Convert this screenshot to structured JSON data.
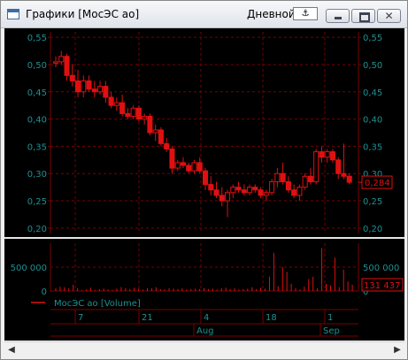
{
  "window": {
    "title": "Графики [МосЭС ао]",
    "period": "Дневной",
    "anchor_glyph": "⚓",
    "buttons": {
      "minimize": "minimize-icon",
      "maximize": "maximize-icon",
      "close": "✕"
    }
  },
  "price_panel": {
    "y_ticks": [
      "0,55",
      "0,50",
      "0,45",
      "0,40",
      "0,35",
      "0,30",
      "0,25",
      "0,20"
    ],
    "last_price": "0,284"
  },
  "volume_panel": {
    "y_ticks": [
      "500 000",
      "0"
    ],
    "last_volume": "131 437"
  },
  "legend": "МосЭС ао [Volume]",
  "time_axis": {
    "days": [
      "7",
      "21",
      "4",
      "18",
      "1"
    ],
    "months": [
      "Aug",
      "Sep"
    ]
  },
  "colors": {
    "candle": "#e01010",
    "grid": "#7a0000",
    "axis_text": "#1e9090",
    "background": "#000000"
  },
  "chart_data": {
    "type": "candlestick",
    "price_ylim": [
      0.19,
      0.56
    ],
    "volume_ylim": [
      0,
      1000000
    ],
    "candles": [
      [
        0.505,
        0.515,
        0.495,
        0.505
      ],
      [
        0.505,
        0.525,
        0.5,
        0.515
      ],
      [
        0.515,
        0.52,
        0.47,
        0.48
      ],
      [
        0.48,
        0.5,
        0.46,
        0.47
      ],
      [
        0.47,
        0.49,
        0.44,
        0.45
      ],
      [
        0.45,
        0.48,
        0.44,
        0.47
      ],
      [
        0.47,
        0.48,
        0.45,
        0.455
      ],
      [
        0.455,
        0.47,
        0.44,
        0.45
      ],
      [
        0.45,
        0.47,
        0.445,
        0.46
      ],
      [
        0.46,
        0.47,
        0.43,
        0.44
      ],
      [
        0.44,
        0.45,
        0.42,
        0.425
      ],
      [
        0.425,
        0.44,
        0.415,
        0.43
      ],
      [
        0.43,
        0.445,
        0.405,
        0.41
      ],
      [
        0.41,
        0.42,
        0.4,
        0.405
      ],
      [
        0.405,
        0.425,
        0.4,
        0.42
      ],
      [
        0.42,
        0.425,
        0.395,
        0.4
      ],
      [
        0.4,
        0.41,
        0.39,
        0.405
      ],
      [
        0.405,
        0.41,
        0.37,
        0.375
      ],
      [
        0.375,
        0.39,
        0.36,
        0.38
      ],
      [
        0.38,
        0.385,
        0.35,
        0.355
      ],
      [
        0.355,
        0.365,
        0.34,
        0.345
      ],
      [
        0.345,
        0.35,
        0.3,
        0.31
      ],
      [
        0.31,
        0.325,
        0.305,
        0.32
      ],
      [
        0.32,
        0.33,
        0.31,
        0.315
      ],
      [
        0.315,
        0.32,
        0.3,
        0.305
      ],
      [
        0.305,
        0.325,
        0.3,
        0.32
      ],
      [
        0.32,
        0.33,
        0.3,
        0.305
      ],
      [
        0.305,
        0.31,
        0.27,
        0.28
      ],
      [
        0.28,
        0.295,
        0.26,
        0.27
      ],
      [
        0.27,
        0.285,
        0.255,
        0.26
      ],
      [
        0.26,
        0.275,
        0.24,
        0.25
      ],
      [
        0.25,
        0.27,
        0.22,
        0.265
      ],
      [
        0.265,
        0.28,
        0.255,
        0.275
      ],
      [
        0.275,
        0.285,
        0.265,
        0.27
      ],
      [
        0.27,
        0.28,
        0.26,
        0.265
      ],
      [
        0.265,
        0.28,
        0.26,
        0.275
      ],
      [
        0.275,
        0.28,
        0.265,
        0.27
      ],
      [
        0.27,
        0.275,
        0.255,
        0.26
      ],
      [
        0.26,
        0.27,
        0.25,
        0.265
      ],
      [
        0.265,
        0.29,
        0.26,
        0.285
      ],
      [
        0.285,
        0.31,
        0.275,
        0.3
      ],
      [
        0.3,
        0.32,
        0.28,
        0.285
      ],
      [
        0.285,
        0.295,
        0.265,
        0.27
      ],
      [
        0.27,
        0.28,
        0.255,
        0.26
      ],
      [
        0.26,
        0.28,
        0.25,
        0.275
      ],
      [
        0.275,
        0.3,
        0.27,
        0.295
      ],
      [
        0.295,
        0.31,
        0.28,
        0.285
      ],
      [
        0.285,
        0.345,
        0.28,
        0.34
      ],
      [
        0.34,
        0.35,
        0.32,
        0.33
      ],
      [
        0.33,
        0.345,
        0.32,
        0.34
      ],
      [
        0.34,
        0.345,
        0.32,
        0.325
      ],
      [
        0.325,
        0.33,
        0.29,
        0.3
      ],
      [
        0.3,
        0.355,
        0.29,
        0.295
      ],
      [
        0.295,
        0.3,
        0.28,
        0.284
      ]
    ],
    "volumes": [
      60000,
      90000,
      80000,
      60000,
      130000,
      60000,
      20000,
      30000,
      70000,
      20000,
      40000,
      50000,
      30000,
      20000,
      50000,
      80000,
      60000,
      40000,
      70000,
      50000,
      30000,
      60000,
      60000,
      80000,
      40000,
      30000,
      60000,
      50000,
      40000,
      60000,
      30000,
      40000,
      50000,
      40000,
      60000,
      40000,
      50000,
      30000,
      60000,
      70000,
      40000,
      60000,
      30000,
      40000,
      50000,
      80000,
      40000,
      70000,
      50000,
      300000,
      800000,
      100000,
      500000,
      400000,
      150000,
      60000,
      30000,
      90000,
      250000,
      300000,
      60000,
      900000,
      150000,
      120000,
      700000,
      80000,
      450000,
      200000,
      131437
    ]
  }
}
